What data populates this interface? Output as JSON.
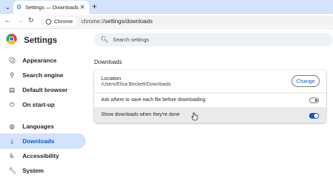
{
  "browser": {
    "tab": {
      "title": "Settings — Downloads",
      "favicon": "gear-icon"
    },
    "omnibox": {
      "chip": "Chrome",
      "url_scheme": "chrome://",
      "url_path": "settings/downloads"
    }
  },
  "header": {
    "title": "Settings",
    "search_placeholder": "Search settings"
  },
  "sidebar": {
    "items": [
      {
        "label": "Appearance",
        "icon": "palette-icon",
        "selected": false
      },
      {
        "label": "Search engine",
        "icon": "search-icon",
        "selected": false
      },
      {
        "label": "Default browser",
        "icon": "browser-window-icon",
        "selected": false
      },
      {
        "label": "On start-up",
        "icon": "power-icon",
        "selected": false
      },
      {
        "label": "Languages",
        "icon": "globe-icon",
        "selected": false
      },
      {
        "label": "Downloads",
        "icon": "download-icon",
        "selected": true
      },
      {
        "label": "Accessibility",
        "icon": "accessibility-icon",
        "selected": false
      },
      {
        "label": "System",
        "icon": "wrench-icon",
        "selected": false
      }
    ]
  },
  "downloads": {
    "section_title": "Downloads",
    "location": {
      "label": "Location",
      "path": "/Users/Elisa Beckett/Downloads",
      "button": "Change"
    },
    "ask_where": {
      "label": "Ask where to save each file before downloading",
      "enabled": false
    },
    "show_when_done": {
      "label": "Show downloads when they're done",
      "enabled": true
    }
  },
  "colors": {
    "accent": "#0b57d0",
    "tabstrip": "#d3e3fd",
    "selected_nav": "#d3e3fd"
  }
}
